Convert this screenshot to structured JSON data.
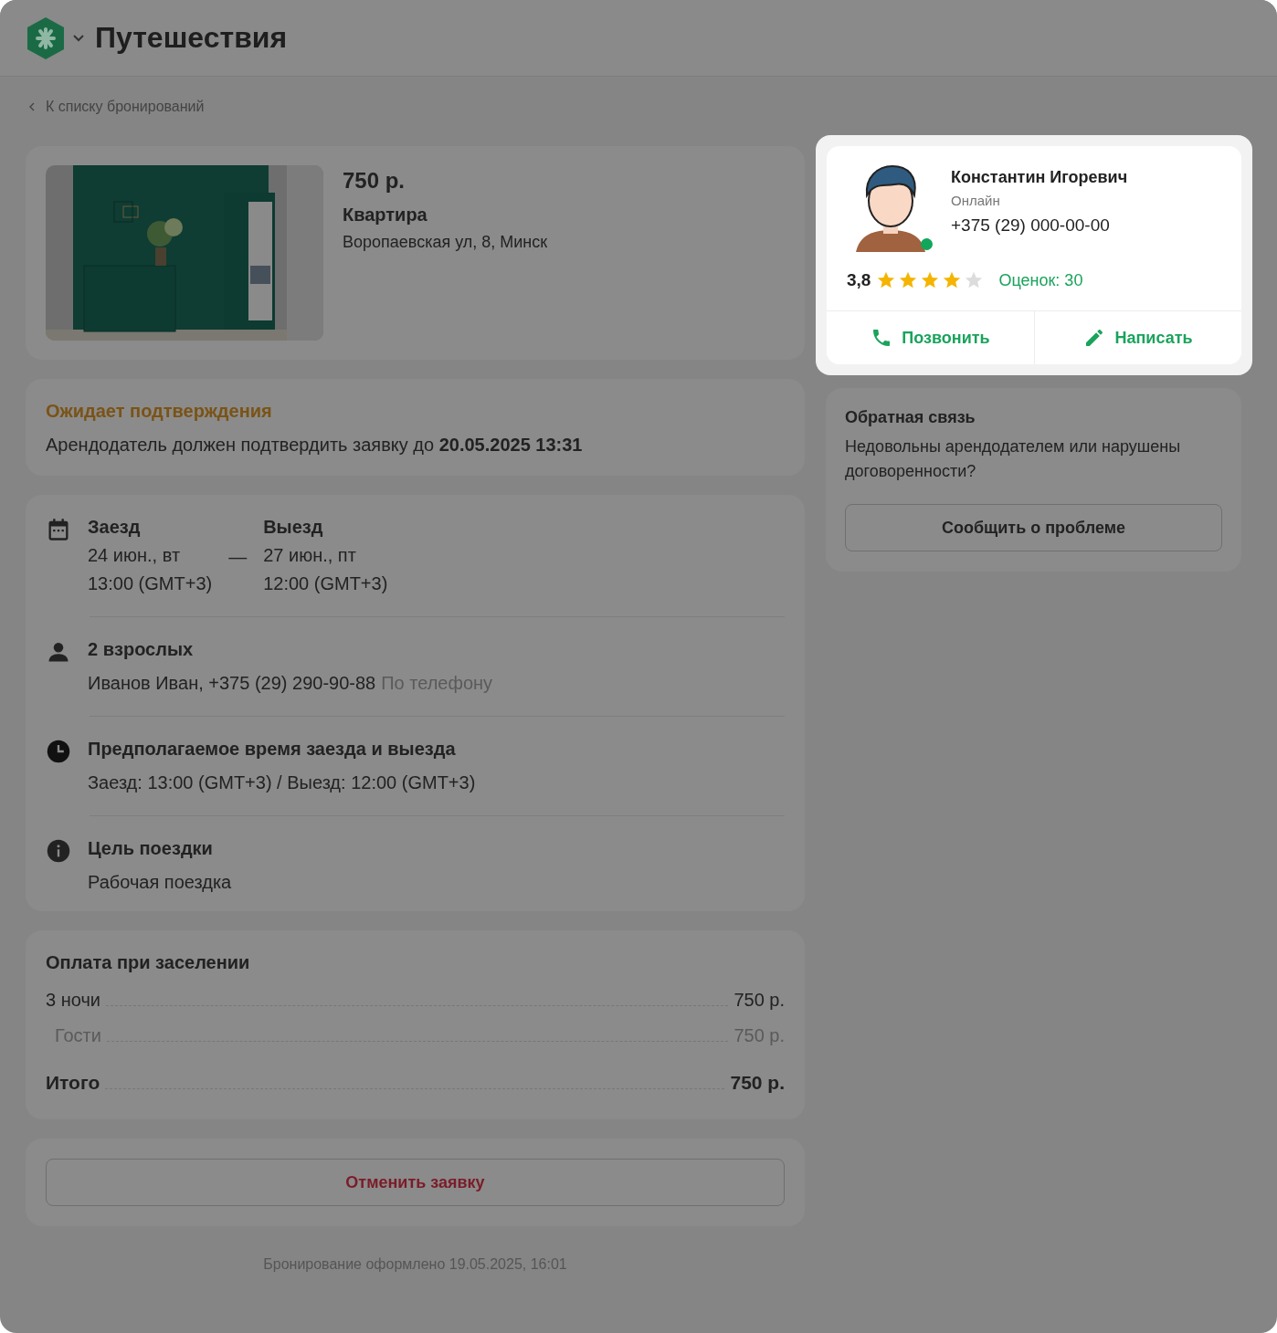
{
  "header": {
    "title": "Путешествия"
  },
  "back_link": "К списку бронирований",
  "listing": {
    "price": "750 р.",
    "type": "Квартира",
    "address": "Воропаевская ул, 8, Минск"
  },
  "status": {
    "title": "Ожидает подтверждения",
    "text": "Арендодатель должен подтвердить заявку до **20.05.2025 13:31**"
  },
  "dates": {
    "checkin_label": "Заезд",
    "checkin_date": "24 июн., вт",
    "checkin_time": "13:00 (GMT+3)",
    "separator": "—",
    "checkout_label": "Выезд",
    "checkout_date": "27 июн., пт",
    "checkout_time": "12:00 (GMT+3)"
  },
  "details": [
    {
      "kind": "guests",
      "title": "2 взрослых",
      "text": "Иванов Иван, +375 (29) 290-90-88",
      "note": "По телефону"
    },
    {
      "kind": "time",
      "title": "Предполагаемое время заезда и выезда",
      "text": "Заезд: 13:00 (GMT+3) / Выезд: 12:00 (GMT+3)"
    },
    {
      "kind": "info",
      "title": "Цель поездки",
      "text": "Рабочая поездка"
    }
  ],
  "payment": {
    "title": "Оплата при заселении",
    "rows": [
      {
        "kind": "main",
        "label": "3 ночи",
        "amount": "750 р."
      },
      {
        "kind": "sub",
        "label": "Гости",
        "amount": "750 р."
      },
      {
        "kind": "total",
        "label": "Итого",
        "amount": "750 р."
      }
    ]
  },
  "cancel_button": "Отменить заявку",
  "footer": "Бронирование оформлено 19.05.2025, 16:01",
  "host": {
    "name": "Константин Игоревич",
    "status": "Онлайн",
    "online": true,
    "phone": "+375 (29) 000-00-00",
    "rating": "3,8",
    "stars": 4,
    "reviews": "Оценок: 30",
    "call_button": "Позвонить",
    "write_button": "Написать"
  },
  "feedback": {
    "title": "Обратная связь",
    "text": "Недовольны арендодателем или нарушены договоренности?",
    "button": "Сообщить о проблеме"
  }
}
